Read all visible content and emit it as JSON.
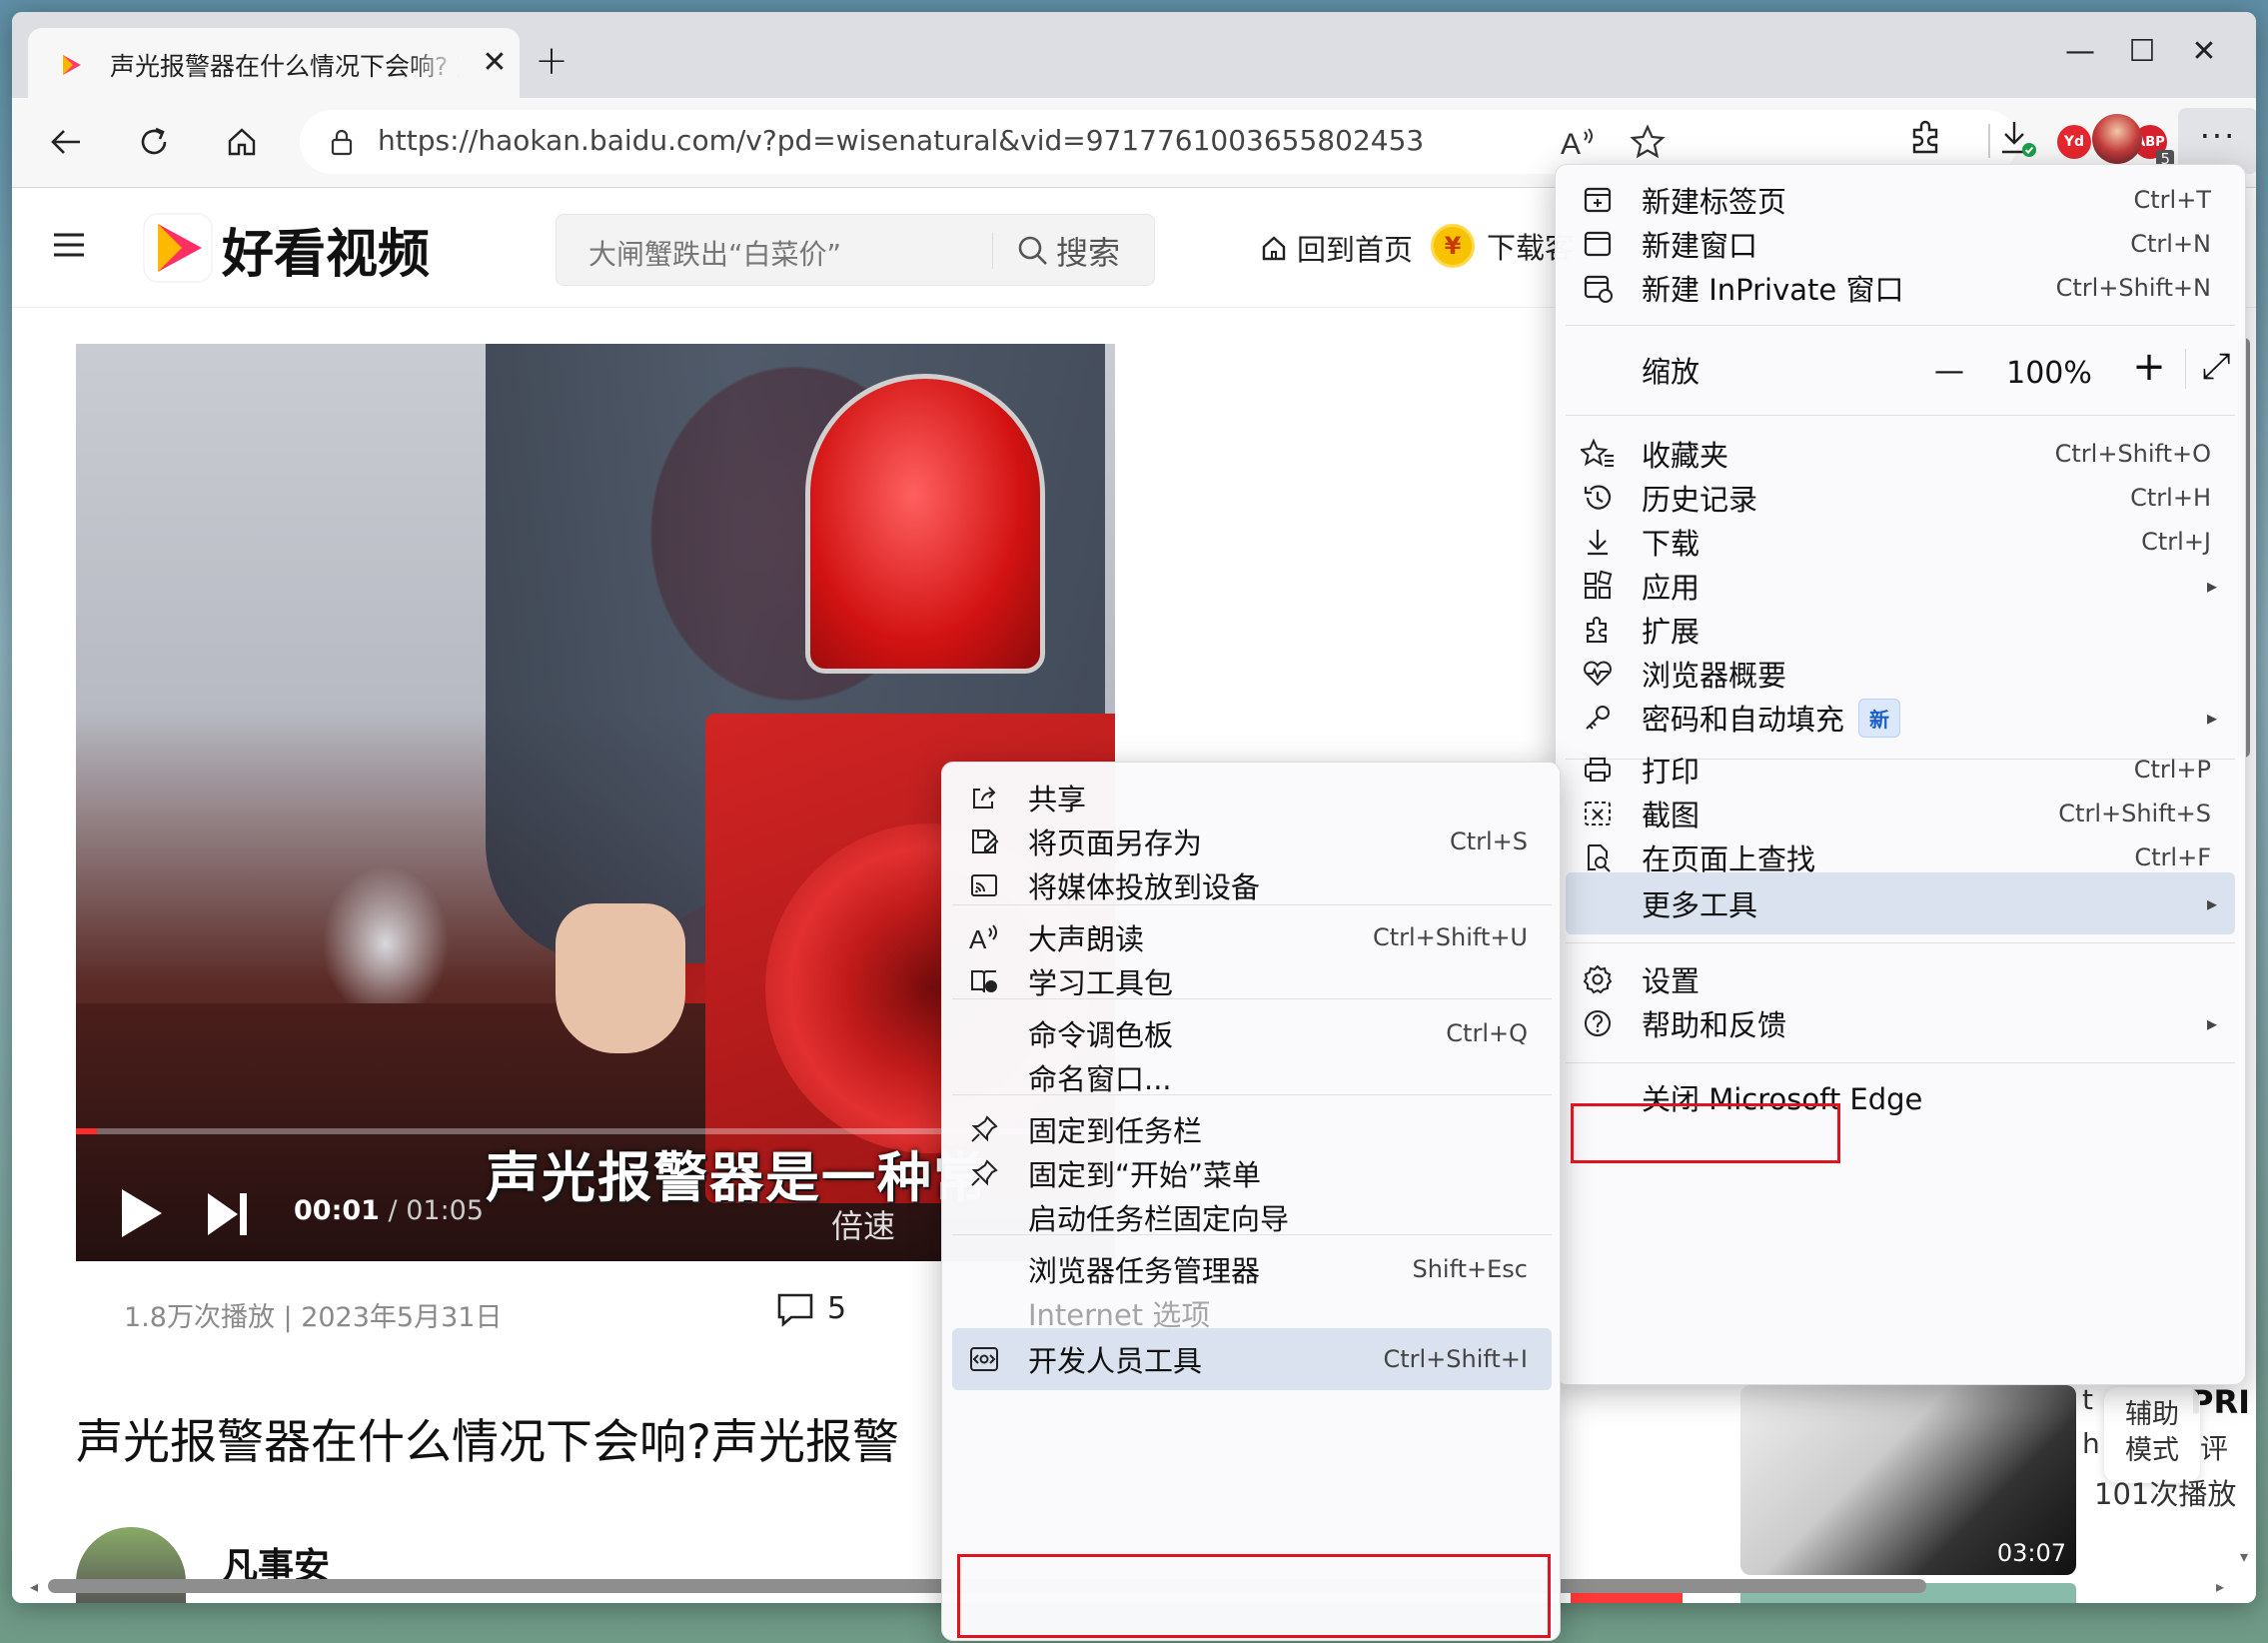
{
  "browser": {
    "tab": {
      "title": "声光报警器在什么情况下会响? 声",
      "close": "✕"
    },
    "new_tab": "+",
    "window_controls": {
      "minimize": "—",
      "maximize": "☐",
      "close": "✕"
    },
    "url": "https://haokan.baidu.com/v?pd=wisenatural&vid=9717761003655802453",
    "extensions": {
      "yd": "Yd",
      "abp": "ABP",
      "abp_count": "5"
    },
    "menu_button": "···"
  },
  "site": {
    "name": "好看视频",
    "search_placeholder": "大闸蟹跌出“白菜价”",
    "search_button": "搜索",
    "home_link": "回到首页",
    "download_link": "下载客",
    "coin_symbol": "¥"
  },
  "video": {
    "subtitle": "声光报警器是一种常",
    "speed": "倍速",
    "current_time": "00:01",
    "separator": " / ",
    "total_time": "01:05",
    "progress": 0.02,
    "close": "✕"
  },
  "meta": {
    "stats": "1.8万次播放 | 2023年5月31日",
    "comments": "5"
  },
  "page_title": "声光报警器在什么情况下会响?声光报警",
  "author_name": "凡事安",
  "recommendation": {
    "duration": "03:07",
    "views": "101次播放",
    "letters": "PRI",
    "assist_line1": "辅助",
    "assist_line2": "模式",
    "side_chars": [
      "t",
      "h",
      "评"
    ]
  },
  "main_menu": {
    "new_tab": {
      "label": "新建标签页",
      "shortcut": "Ctrl+T"
    },
    "new_window": {
      "label": "新建窗口",
      "shortcut": "Ctrl+N"
    },
    "new_inprivate": {
      "label": "新建 InPrivate 窗口",
      "shortcut": "Ctrl+Shift+N"
    },
    "zoom": {
      "label": "缩放",
      "minus": "—",
      "value": "100%",
      "plus": "+",
      "fullscreen": "⤢"
    },
    "favorites": {
      "label": "收藏夹",
      "shortcut": "Ctrl+Shift+O"
    },
    "history": {
      "label": "历史记录",
      "shortcut": "Ctrl+H"
    },
    "downloads": {
      "label": "下载",
      "shortcut": "Ctrl+J"
    },
    "apps": {
      "label": "应用"
    },
    "extensions": {
      "label": "扩展"
    },
    "essentials": {
      "label": "浏览器概要"
    },
    "passwords": {
      "label": "密码和自动填充",
      "badge": "新"
    },
    "print": {
      "label": "打印",
      "shortcut": "Ctrl+P"
    },
    "screenshot": {
      "label": "截图",
      "shortcut": "Ctrl+Shift+S"
    },
    "find": {
      "label": "在页面上查找",
      "shortcut": "Ctrl+F"
    },
    "more_tools": {
      "label": "更多工具"
    },
    "settings": {
      "label": "设置"
    },
    "help": {
      "label": "帮助和反馈"
    },
    "close_edge": {
      "label": "关闭 Microsoft Edge"
    },
    "arrow": "▸"
  },
  "sub_menu": {
    "share": {
      "label": "共享"
    },
    "save_as": {
      "label": "将页面另存为",
      "shortcut": "Ctrl+S"
    },
    "cast": {
      "label": "将媒体投放到设备"
    },
    "read_aloud": {
      "label": "大声朗读",
      "shortcut": "Ctrl+Shift+U"
    },
    "learning_toolkit": {
      "label": "学习工具包"
    },
    "command_palette": {
      "label": "命令调色板",
      "shortcut": "Ctrl+Q"
    },
    "name_window": {
      "label": "命名窗口..."
    },
    "pin_taskbar": {
      "label": "固定到任务栏"
    },
    "pin_start": {
      "label": "固定到“开始”菜单"
    },
    "pin_wizard": {
      "label": "启动任务栏固定向导"
    },
    "task_manager": {
      "label": "浏览器任务管理器",
      "shortcut": "Shift+Esc"
    },
    "internet_options": {
      "label": "Internet 选项"
    },
    "dev_tools": {
      "label": "开发人员工具",
      "shortcut": "Ctrl+Shift+I"
    }
  },
  "colors": {
    "accent": "#e0141e",
    "highlight": "#d9e2ee",
    "progress": "#ff2a2a"
  }
}
